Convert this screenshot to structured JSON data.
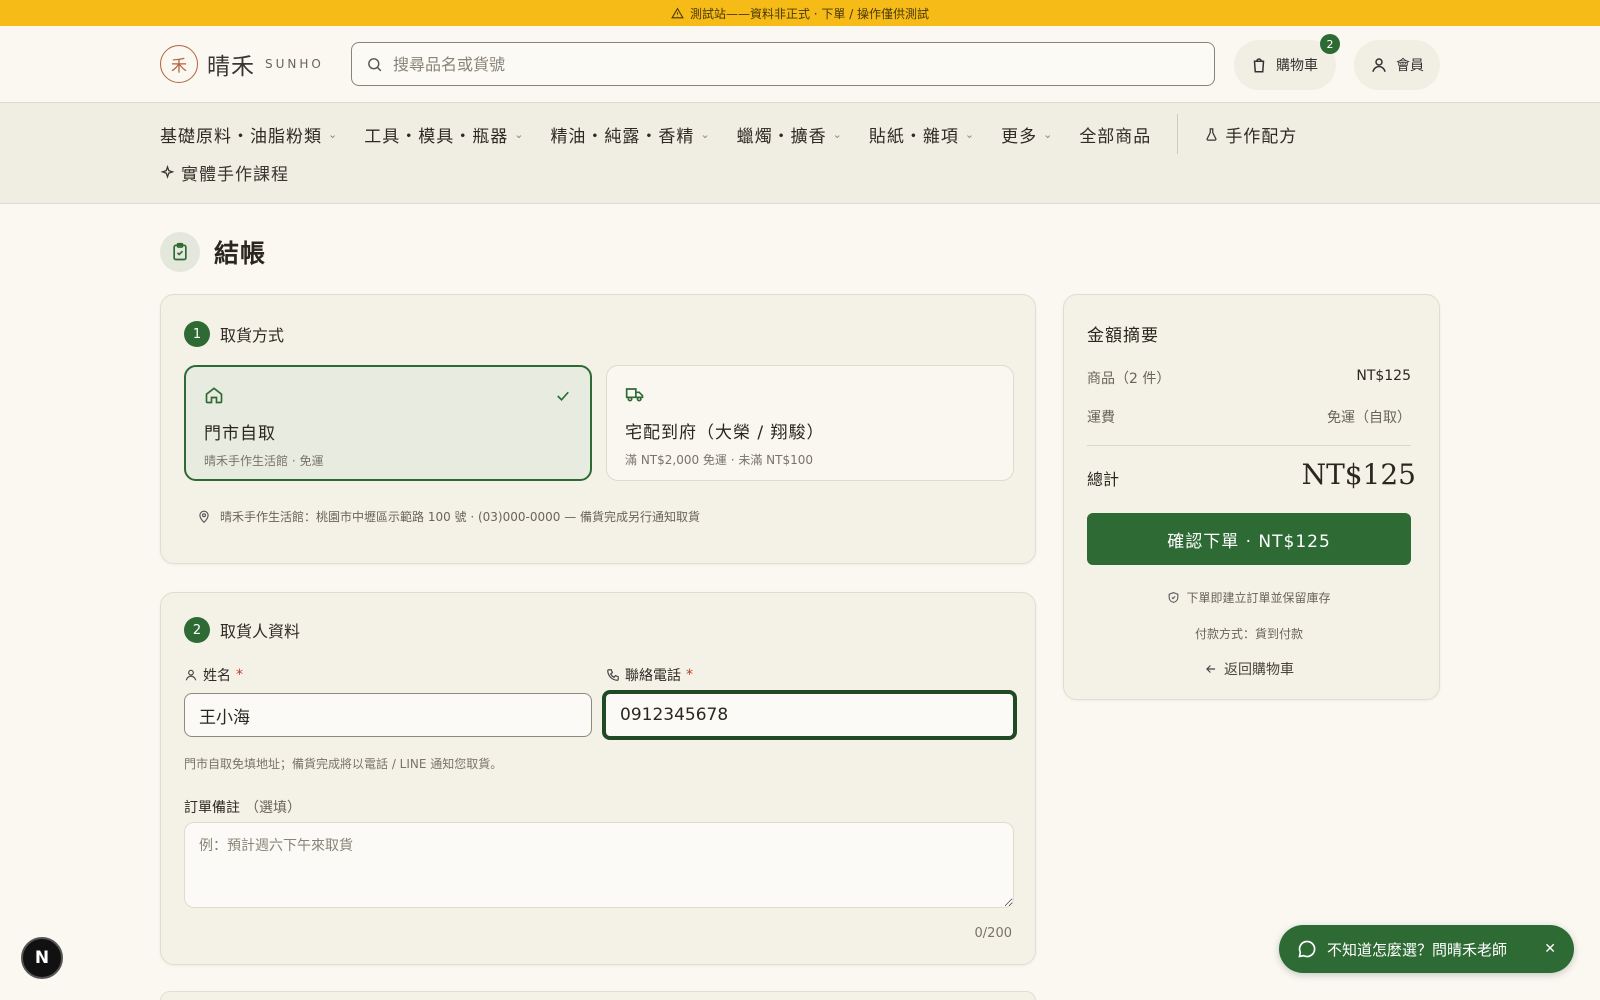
{
  "banner": {
    "text": "測試站——資料非正式 · 下單 / 操作僅供測試"
  },
  "header": {
    "logo_mark": "禾",
    "logo_cn": "晴禾",
    "logo_en": "SUNHO",
    "search_placeholder": "搜尋品名或貨號",
    "cart_label": "購物車",
    "cart_count": "2",
    "member_label": "會員"
  },
  "nav": {
    "items": [
      {
        "label": "基礎原料・油脂粉類",
        "has_dropdown": true
      },
      {
        "label": "工具・模具・瓶器",
        "has_dropdown": true
      },
      {
        "label": "精油・純露・香精",
        "has_dropdown": true
      },
      {
        "label": "蠟燭・擴香",
        "has_dropdown": true
      },
      {
        "label": "貼紙・雜項",
        "has_dropdown": true
      },
      {
        "label": "更多",
        "has_dropdown": true
      },
      {
        "label": "全部商品",
        "has_dropdown": false
      }
    ],
    "recipes_label": "手作配方",
    "courses_label": "實體手作課程"
  },
  "page": {
    "title": "結帳"
  },
  "pickup": {
    "step": "1",
    "heading": "取貨方式",
    "options": [
      {
        "title": "門市自取",
        "subtitle": "晴禾手作生活館 · 免運",
        "selected": true
      },
      {
        "title": "宅配到府（大榮 / 翔駿）",
        "subtitle": "滿 NT$2,000 免運 · 未滿 NT$100",
        "selected": false
      }
    ],
    "store_note": "晴禾手作生活館：桃園市中壢區示範路 100 號 · (03)000-0000 — 備貨完成另行通知取貨"
  },
  "recipient": {
    "step": "2",
    "heading": "取貨人資料",
    "name_label": "姓名",
    "name_value": "王小海",
    "phone_label": "聯絡電話",
    "phone_value": "0912345678",
    "required_mark": "*",
    "hint": "門市自取免填地址；備貨完成將以電話 / LINE 通知您取貨。",
    "note_label": "訂單備註",
    "note_optional": "（選填）",
    "note_placeholder": "例：預計週六下午來取貨",
    "note_counter": "0/200"
  },
  "summary": {
    "title": "金額摘要",
    "items_label": "商品（2 件）",
    "items_value": "NT$125",
    "shipping_label": "運費",
    "shipping_value": "免運（自取）",
    "total_label": "總計",
    "total_value": "NT$125",
    "confirm_label": "確認下單 · NT$125",
    "secure_note": "下單即建立訂單並保留庫存",
    "payment_note": "付款方式：貨到付款",
    "back_label": "返回購物車"
  },
  "floating": {
    "n_badge": "N",
    "chat_label": "不知道怎麼選？問晴禾老師",
    "chat_close": "✕"
  },
  "colors": {
    "primary": "#2d6a34",
    "banner": "#f6bb16",
    "background": "#faf8f1"
  }
}
